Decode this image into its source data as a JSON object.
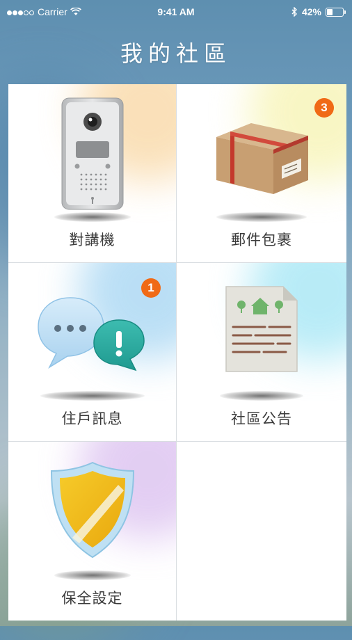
{
  "status_bar": {
    "carrier": "Carrier",
    "time": "9:41 AM",
    "battery": "42%",
    "battery_level": 0.42
  },
  "page_title": "我的社區",
  "tiles": [
    {
      "label": "對講機",
      "icon": "intercom-icon",
      "badge": null,
      "glow": "#f9d9a8"
    },
    {
      "label": "郵件包裹",
      "icon": "package-icon",
      "badge": "3",
      "glow": "#f7f4b6"
    },
    {
      "label": "住戶訊息",
      "icon": "chat-bubbles-icon",
      "badge": "1",
      "glow": "#a9d7f3"
    },
    {
      "label": "社區公告",
      "icon": "bulletin-document-icon",
      "badge": null,
      "glow": "#a7e7f5"
    },
    {
      "label": "保全設定",
      "icon": "security-shield-icon",
      "badge": null,
      "glow": "#dcc2f0"
    },
    {
      "label": "",
      "icon": "",
      "badge": null,
      "glow": ""
    }
  ],
  "colors": {
    "badge": "#f06a16",
    "title": "#ffffff"
  }
}
